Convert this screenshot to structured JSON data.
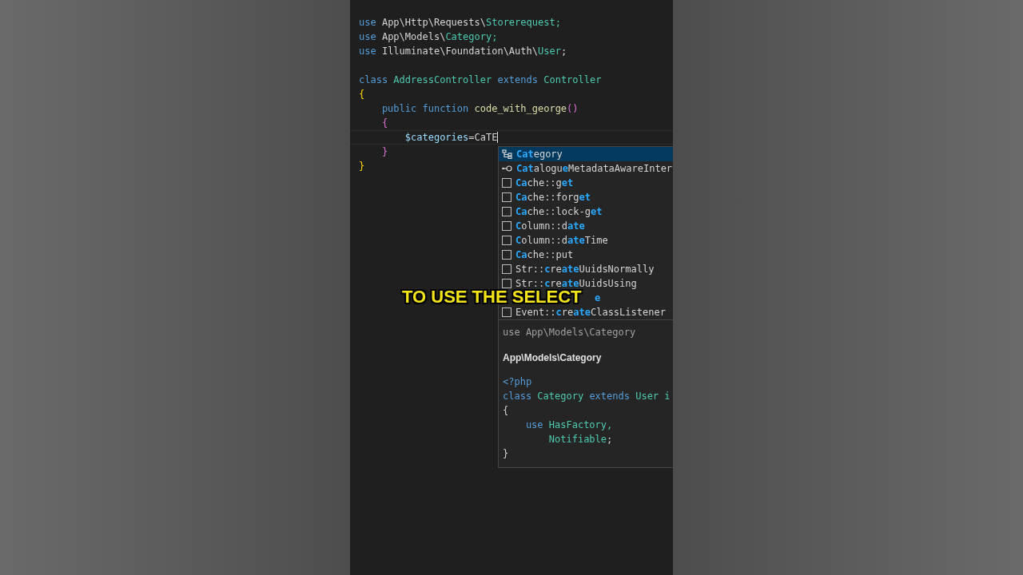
{
  "editor": {
    "blocks": [
      [
        {
          "cursor": false,
          "tokens": [
            {
              "text": "use",
              "color": "#569cd6"
            },
            {
              "text": " App\\Http\\Requests\\",
              "color": "#d4d4d4"
            },
            {
              "text": "Storerequest;",
              "color": "#4ec9b0"
            }
          ]
        },
        {
          "cursor": false,
          "tokens": [
            {
              "text": "use",
              "color": "#569cd6"
            },
            {
              "text": " App\\Models\\",
              "color": "#d4d4d4"
            },
            {
              "text": "Category;",
              "color": "#4ec9b0"
            }
          ]
        },
        {
          "cursor": false,
          "tokens": [
            {
              "text": "use",
              "color": "#569cd6"
            },
            {
              "text": " Illuminate\\Foundation\\Auth\\",
              "color": "#d4d4d4"
            },
            {
              "text": "User",
              "color": "#4ec9b0"
            },
            {
              "text": ";",
              "color": "#d4d4d4"
            }
          ]
        }
      ],
      [
        {
          "cursor": false,
          "tokens": [
            {
              "text": "class ",
              "color": "#569cd6"
            },
            {
              "text": "AddressController ",
              "color": "#4ec9b0"
            },
            {
              "text": "extends ",
              "color": "#569cd6"
            },
            {
              "text": "Controller",
              "color": "#4ec9b0"
            }
          ]
        },
        {
          "cursor": false,
          "tokens": [
            {
              "text": "{",
              "color": "#ffd700"
            }
          ]
        },
        {
          "cursor": false,
          "tokens": [
            {
              "text": "    public function ",
              "color": "#569cd6"
            },
            {
              "text": "code_with_george",
              "color": "#dcdcaa"
            },
            {
              "text": "()",
              "color": "#da70d6"
            }
          ]
        },
        {
          "cursor": false,
          "tokens": [
            {
              "text": "    {",
              "color": "#da70d6"
            }
          ]
        },
        {
          "cursor": true,
          "tokens": [
            {
              "text": "        $categories",
              "color": "#9cdcfe"
            },
            {
              "text": "=CaTE",
              "color": "#d4d4d4"
            }
          ]
        },
        {
          "cursor": false,
          "tokens": [
            {
              "text": "    }",
              "color": "#da70d6"
            }
          ]
        },
        {
          "cursor": false,
          "tokens": [
            {
              "text": "}",
              "color": "#ffd700"
            }
          ]
        }
      ]
    ]
  },
  "suggestions": {
    "items": [
      {
        "kind": "class",
        "selected": true,
        "label": "**Cat**egory"
      },
      {
        "kind": "interface",
        "selected": false,
        "label": "**Cat**alogu**e**MetadataAwareInter"
      },
      {
        "kind": "snippet",
        "selected": false,
        "label": "**Ca**che::g**et**"
      },
      {
        "kind": "snippet",
        "selected": false,
        "label": "**Ca**che::forg**et**"
      },
      {
        "kind": "snippet",
        "selected": false,
        "label": "**Ca**che::lock-g**et**"
      },
      {
        "kind": "snippet",
        "selected": false,
        "label": "**C**olumn::d**ate**"
      },
      {
        "kind": "snippet",
        "selected": false,
        "label": "**C**olumn::d**ate**Time"
      },
      {
        "kind": "snippet",
        "selected": false,
        "label": "**Ca**che::put"
      },
      {
        "kind": "snippet",
        "selected": false,
        "label": "Str::**c**re**ate**UuidsNormally"
      },
      {
        "kind": "snippet",
        "selected": false,
        "label": "Str::**c**re**ate**UuidsUsing"
      },
      {
        "kind": "covered",
        "selected": false,
        "label": "**e**"
      },
      {
        "kind": "snippet",
        "selected": false,
        "label": "Event::**c**re**ate**ClassListener"
      }
    ],
    "detail": {
      "signature": "use App\\Models\\Category",
      "title": "App\\Models\\Category",
      "code": [
        [
          {
            "text": "<?php",
            "color": "#569cd6"
          }
        ],
        [
          {
            "text": "class ",
            "color": "#569cd6"
          },
          {
            "text": "Category ",
            "color": "#4ec9b0"
          },
          {
            "text": "extends ",
            "color": "#569cd6"
          },
          {
            "text": "User i",
            "color": "#4ec9b0"
          }
        ],
        [
          {
            "text": "{",
            "color": "#d4d4d4"
          }
        ],
        [
          {
            "text": "    use ",
            "color": "#569cd6"
          },
          {
            "text": "HasFactory,",
            "color": "#4ec9b0"
          }
        ],
        [
          {
            "text": "        Notifiable",
            "color": "#4ec9b0"
          },
          {
            "text": ";",
            "color": "#d4d4d4"
          }
        ],
        [
          {
            "text": "}",
            "color": "#d4d4d4"
          }
        ]
      ]
    }
  },
  "caption": "TO USE THE SELECT"
}
